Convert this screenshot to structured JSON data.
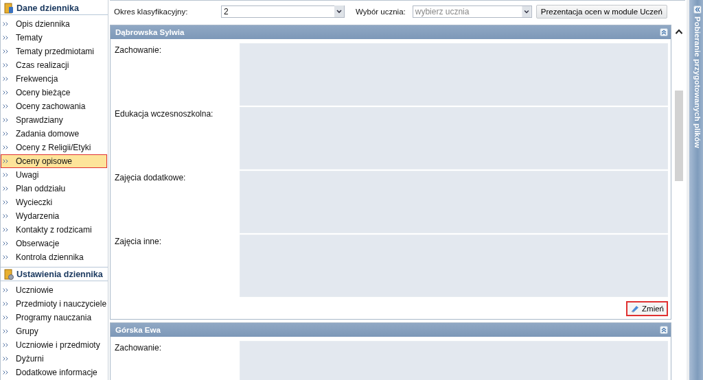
{
  "sidebar": {
    "sections": [
      {
        "title": "Dane dziennika",
        "kind": "journal",
        "items": [
          {
            "label": "Opis dziennika",
            "selected": false
          },
          {
            "label": "Tematy",
            "selected": false
          },
          {
            "label": "Tematy przedmiotami",
            "selected": false
          },
          {
            "label": "Czas realizacji",
            "selected": false
          },
          {
            "label": "Frekwencja",
            "selected": false
          },
          {
            "label": "Oceny bieżące",
            "selected": false
          },
          {
            "label": "Oceny zachowania",
            "selected": false
          },
          {
            "label": "Sprawdziany",
            "selected": false
          },
          {
            "label": "Zadania domowe",
            "selected": false
          },
          {
            "label": "Oceny z Religii/Etyki",
            "selected": false
          },
          {
            "label": "Oceny opisowe",
            "selected": true
          },
          {
            "label": "Uwagi",
            "selected": false
          },
          {
            "label": "Plan oddziału",
            "selected": false
          },
          {
            "label": "Wycieczki",
            "selected": false
          },
          {
            "label": "Wydarzenia",
            "selected": false
          },
          {
            "label": "Kontakty z rodzicami",
            "selected": false
          },
          {
            "label": "Obserwacje",
            "selected": false
          },
          {
            "label": "Kontrola dziennika",
            "selected": false
          }
        ]
      },
      {
        "title": "Ustawienia dziennika",
        "kind": "settings",
        "items": [
          {
            "label": "Uczniowie",
            "selected": false
          },
          {
            "label": "Przedmioty i nauczyciele",
            "selected": false
          },
          {
            "label": "Programy nauczania",
            "selected": false
          },
          {
            "label": "Grupy",
            "selected": false
          },
          {
            "label": "Uczniowie i przedmioty",
            "selected": false
          },
          {
            "label": "Dyżurni",
            "selected": false
          },
          {
            "label": "Dodatkowe informacje",
            "selected": false
          }
        ]
      }
    ]
  },
  "filters": {
    "period": {
      "label": "Okres klasyfikacyjny:",
      "value": "2"
    },
    "student": {
      "label": "Wybór ucznia:",
      "placeholder": "wybierz ucznia"
    },
    "button": "Prezentacja ocen w module Uczeń"
  },
  "panels": [
    {
      "title": "Dąbrowska Sylwia",
      "fields": [
        {
          "label": "Zachowanie:"
        },
        {
          "label": "Edukacja wczesnoszkolna:"
        },
        {
          "label": "Zajęcia dodatkowe:"
        },
        {
          "label": "Zajęcia inne:"
        }
      ],
      "button": "Zmień"
    },
    {
      "title": "Górska Ewa",
      "fields": [
        {
          "label": "Zachowanie:"
        }
      ]
    }
  ],
  "side_panel": {
    "title": "Pobieranie przygotowanych plików"
  }
}
